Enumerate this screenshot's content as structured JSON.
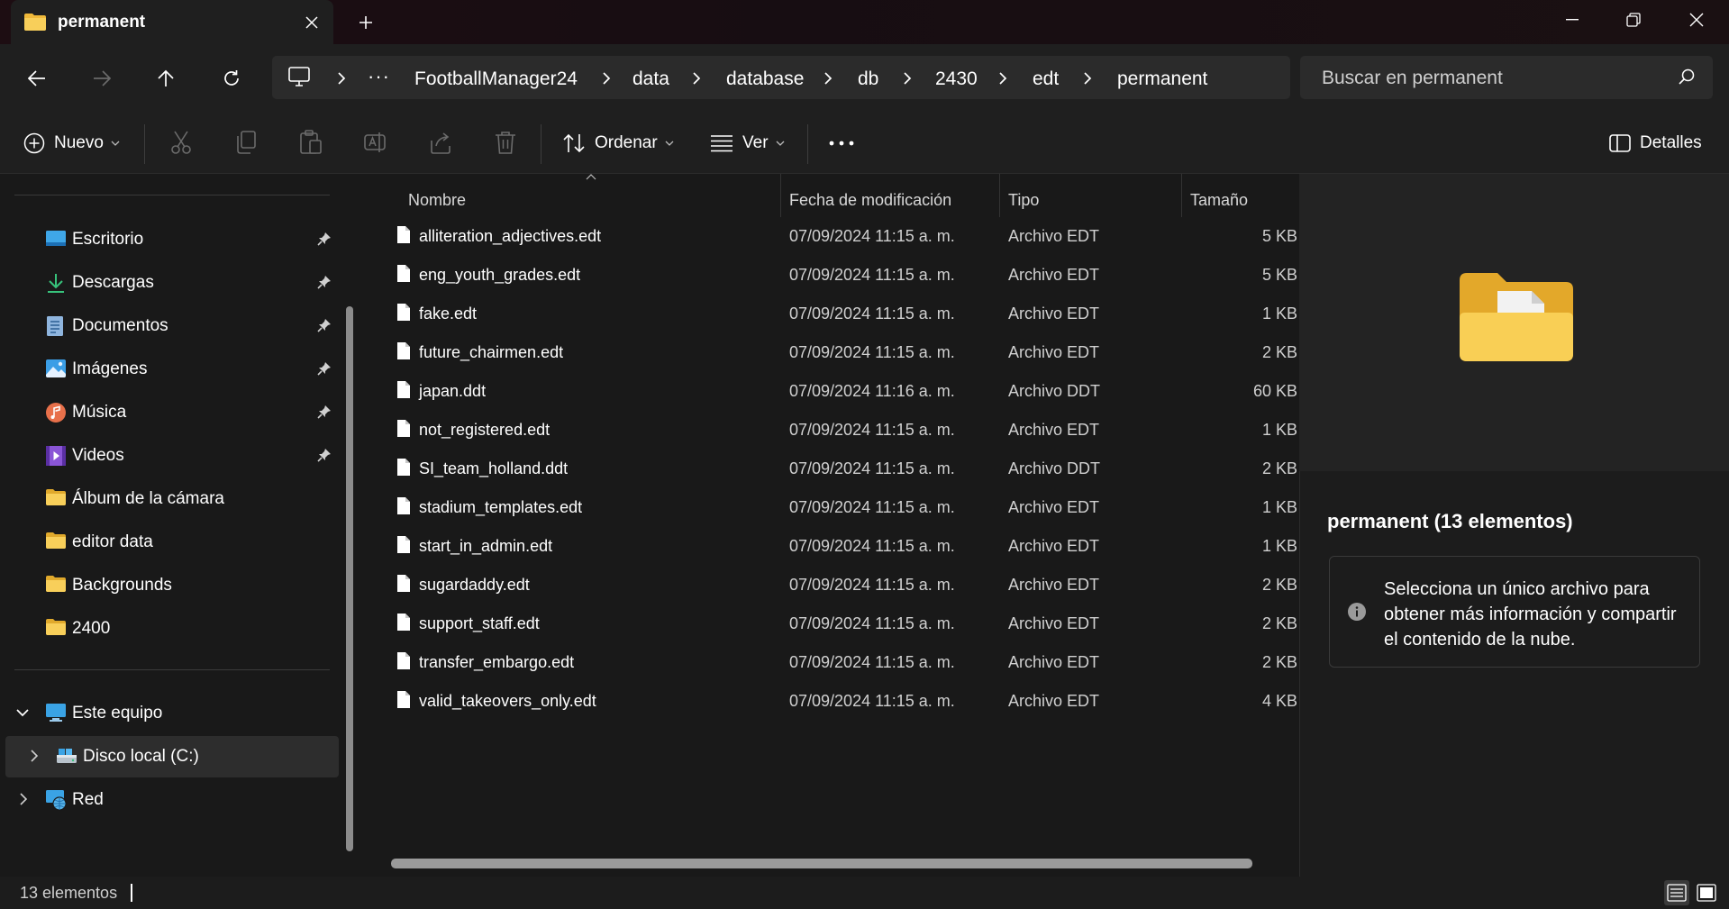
{
  "window": {
    "tab_title": "permanent"
  },
  "breadcrumbs": [
    "FootballManager24",
    "data",
    "database",
    "db",
    "2430",
    "edt",
    "permanent"
  ],
  "search": {
    "placeholder": "Buscar en permanent"
  },
  "commands": {
    "new_label": "Nuevo",
    "sort_label": "Ordenar",
    "view_label": "Ver",
    "details_label": "Detalles"
  },
  "sidebar": {
    "quick_access": [
      {
        "label": "Escritorio",
        "icon": "desktop-icon",
        "pinned": true
      },
      {
        "label": "Descargas",
        "icon": "download-icon",
        "pinned": true
      },
      {
        "label": "Documentos",
        "icon": "documents-icon",
        "pinned": true
      },
      {
        "label": "Imágenes",
        "icon": "pictures-icon",
        "pinned": true
      },
      {
        "label": "Música",
        "icon": "music-icon",
        "pinned": true
      },
      {
        "label": "Videos",
        "icon": "videos-icon",
        "pinned": true
      },
      {
        "label": "Álbum de la cámara",
        "icon": "folder-icon",
        "pinned": false
      },
      {
        "label": "editor data",
        "icon": "folder-icon",
        "pinned": false
      },
      {
        "label": "Backgrounds",
        "icon": "folder-icon",
        "pinned": false
      },
      {
        "label": "2400",
        "icon": "folder-icon",
        "pinned": false
      }
    ],
    "this_pc": "Este equipo",
    "local_disk": "Disco local (C:)",
    "network": "Red"
  },
  "columns": {
    "name": "Nombre",
    "modified": "Fecha de modificación",
    "type": "Tipo",
    "size": "Tamaño"
  },
  "files": [
    {
      "name": "alliteration_adjectives.edt",
      "modified": "07/09/2024 11:15 a. m.",
      "type": "Archivo EDT",
      "size": "5 KB"
    },
    {
      "name": "eng_youth_grades.edt",
      "modified": "07/09/2024 11:15 a. m.",
      "type": "Archivo EDT",
      "size": "5 KB"
    },
    {
      "name": "fake.edt",
      "modified": "07/09/2024 11:15 a. m.",
      "type": "Archivo EDT",
      "size": "1 KB"
    },
    {
      "name": "future_chairmen.edt",
      "modified": "07/09/2024 11:15 a. m.",
      "type": "Archivo EDT",
      "size": "2 KB"
    },
    {
      "name": "japan.ddt",
      "modified": "07/09/2024 11:16 a. m.",
      "type": "Archivo DDT",
      "size": "60 KB"
    },
    {
      "name": "not_registered.edt",
      "modified": "07/09/2024 11:15 a. m.",
      "type": "Archivo EDT",
      "size": "1 KB"
    },
    {
      "name": "SI_team_holland.ddt",
      "modified": "07/09/2024 11:15 a. m.",
      "type": "Archivo DDT",
      "size": "2 KB"
    },
    {
      "name": "stadium_templates.edt",
      "modified": "07/09/2024 11:15 a. m.",
      "type": "Archivo EDT",
      "size": "1 KB"
    },
    {
      "name": "start_in_admin.edt",
      "modified": "07/09/2024 11:15 a. m.",
      "type": "Archivo EDT",
      "size": "1 KB"
    },
    {
      "name": "sugardaddy.edt",
      "modified": "07/09/2024 11:15 a. m.",
      "type": "Archivo EDT",
      "size": "2 KB"
    },
    {
      "name": "support_staff.edt",
      "modified": "07/09/2024 11:15 a. m.",
      "type": "Archivo EDT",
      "size": "2 KB"
    },
    {
      "name": "transfer_embargo.edt",
      "modified": "07/09/2024 11:15 a. m.",
      "type": "Archivo EDT",
      "size": "2 KB"
    },
    {
      "name": "valid_takeovers_only.edt",
      "modified": "07/09/2024 11:15 a. m.",
      "type": "Archivo EDT",
      "size": "4 KB"
    }
  ],
  "details": {
    "title": "permanent (13 elementos)",
    "info": "Selecciona un único archivo para obtener más información y compartir el contenido de la nube."
  },
  "status": {
    "count": "13 elementos"
  },
  "colors": {
    "accent": "#4cc2ff",
    "folder": "#f7c948"
  }
}
